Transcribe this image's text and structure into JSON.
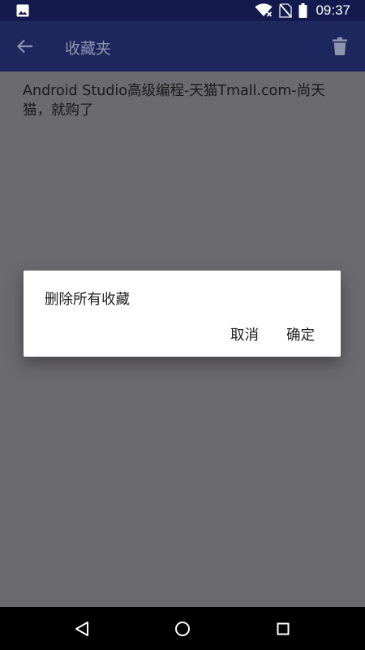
{
  "status_bar": {
    "time": "09:37",
    "icons": [
      "gallery-icon",
      "wifi-icon",
      "no-sim-icon",
      "battery-icon"
    ]
  },
  "app_bar": {
    "title": "收藏夹",
    "icons": [
      "back-arrow-icon",
      "trash-icon"
    ]
  },
  "list": {
    "items": [
      {
        "text": "Android Studio高级编程-天猫Tmall.com-尚天猫，就购了"
      }
    ]
  },
  "dialog": {
    "message": "删除所有收藏",
    "cancel_label": "取消",
    "ok_label": "确定"
  },
  "nav_bar": {
    "icons": [
      "nav-back-icon",
      "nav-home-icon",
      "nav-recents-icon"
    ]
  },
  "colors": {
    "status_bar": "#131b4e",
    "app_bar_dimmed": "#1e285e",
    "scrim_background": "#6b6a6f",
    "dialog_background": "#ffffff"
  }
}
